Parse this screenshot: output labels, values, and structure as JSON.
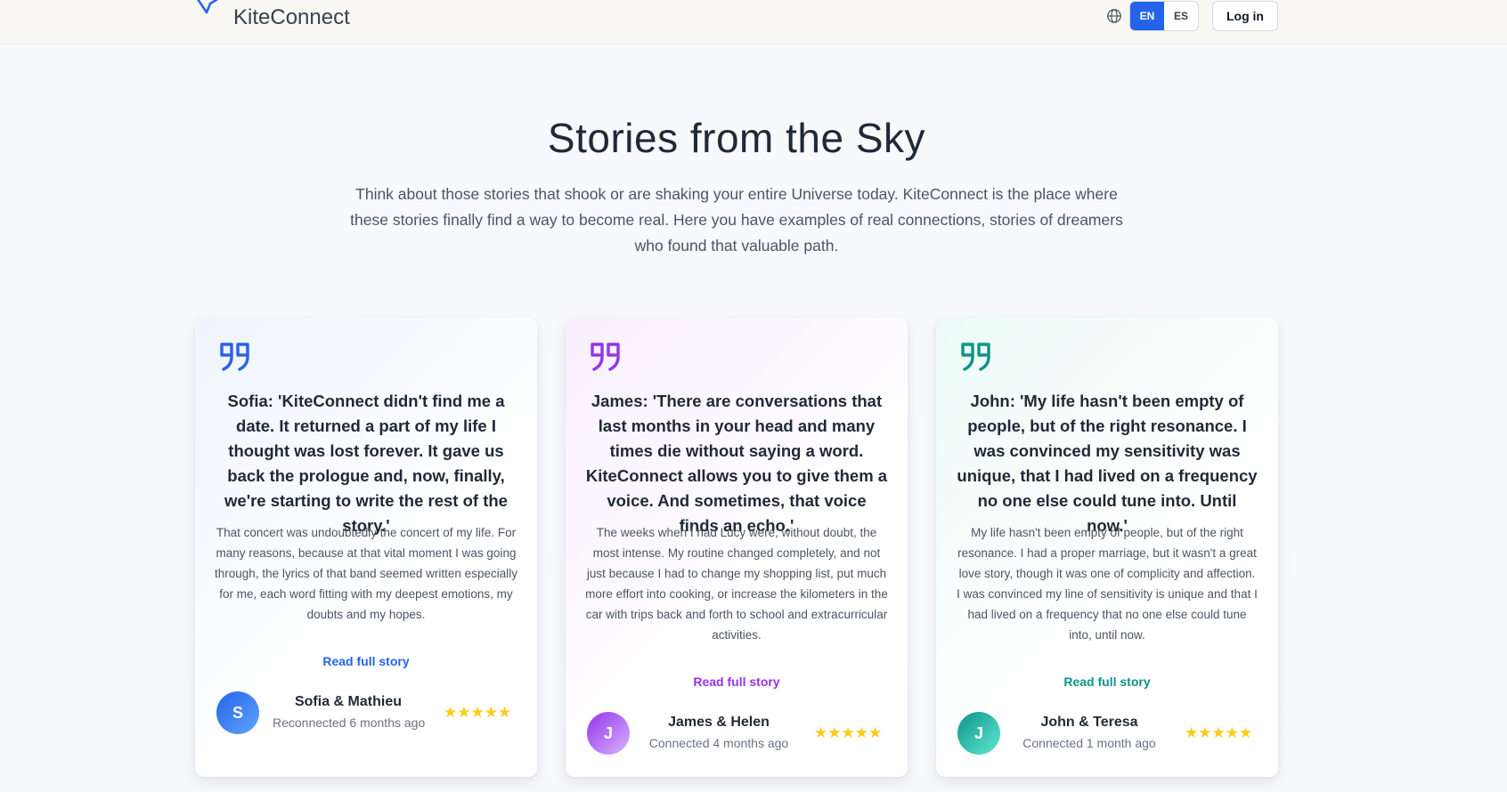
{
  "brand": {
    "name": "KiteConnect"
  },
  "header": {
    "languages": [
      "EN",
      "ES"
    ],
    "active_language": "EN",
    "login_label": "Log in"
  },
  "hero": {
    "title": "Stories from the Sky",
    "subtitle": "Think about those stories that shook or are shaking your entire Universe today. KiteConnect is the place where these stories finally find a way to become real. Here you have examples of real connections, stories of dreamers who found that valuable path."
  },
  "stories": [
    {
      "accent": "#2563eb",
      "quote": "Sofia: 'KiteConnect didn't find me a date. It returned a part of my life I thought was lost forever. It gave us back the prologue and, now, finally, we're starting to write the rest of the story.'",
      "body": "That concert was undoubtedly the concert of my life. For many reasons, because at that vital moment I was going through, the lyrics of that band seemed written especially for me, each word fitting with my deepest emotions, my doubts and my hopes.",
      "read_more": "Read full story",
      "avatar_initial": "S",
      "names": "Sofia & Mathieu",
      "meta": "Reconnected 6 months ago",
      "rating": 5
    },
    {
      "accent": "#9333ea",
      "quote": "James: 'There are conversations that last months in your head and many times die without saying a word. KiteConnect allows you to give them a voice. And sometimes, that voice finds an echo.'",
      "body": "The weeks when I had Lucy were, without doubt, the most intense. My routine changed completely, and not just because I had to change my shopping list, put much more effort into cooking, or increase the kilometers in the car with trips back and forth to school and extracurricular activities.",
      "read_more": "Read full story",
      "avatar_initial": "J",
      "names": "James & Helen",
      "meta": "Connected 4 months ago",
      "rating": 5
    },
    {
      "accent": "#0d9488",
      "quote": "John: 'My life hasn't been empty of people, but of the right resonance. I was convinced my sensitivity was unique, that I had lived on a frequency no one else could tune into. Until now.'",
      "body": "My life hasn't been empty of people, but of the right resonance. I had a proper marriage, but it wasn't a great love story, though it was one of complicity and affection. I was convinced my line of sensitivity is unique and that I had lived on a frequency that no one else could tune into, until now.",
      "read_more": "Read full story",
      "avatar_initial": "J",
      "names": "John & Teresa",
      "meta": "Connected 1 month ago",
      "rating": 5
    }
  ],
  "stars_text": "★★★★★"
}
